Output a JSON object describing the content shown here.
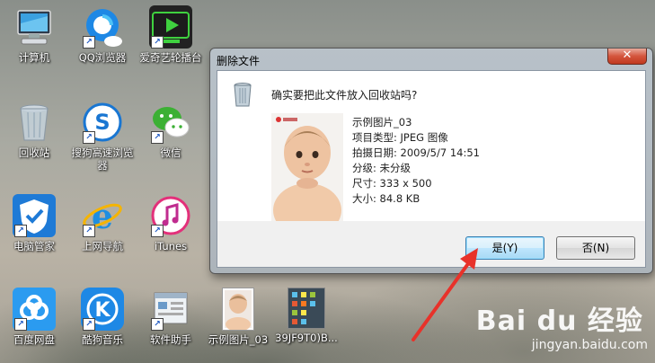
{
  "desktop": {
    "icons": [
      {
        "label": "计算机",
        "icon": "computer-icon"
      },
      {
        "label": "QQ浏览器",
        "icon": "qq-browser-icon"
      },
      {
        "label": "爱奇艺轮播台",
        "icon": "iqiyi-icon"
      },
      {
        "label": "回收站",
        "icon": "recycle-bin-icon"
      },
      {
        "label": "搜狗高速浏览器",
        "icon": "sogou-browser-icon"
      },
      {
        "label": "微信",
        "icon": "wechat-icon"
      },
      {
        "label": "电脑管家",
        "icon": "pc-manager-icon"
      },
      {
        "label": "上网导航",
        "icon": "ie-icon"
      },
      {
        "label": "iTunes",
        "icon": "itunes-icon"
      },
      {
        "label": "百度网盘",
        "icon": "baidu-netdisk-icon"
      },
      {
        "label": "酷狗音乐",
        "icon": "kugou-icon"
      },
      {
        "label": "软件助手",
        "icon": "software-assistant-icon"
      },
      {
        "label": "示例图片_03",
        "icon": "image-file-icon"
      },
      {
        "label": "39JF9T0)B...",
        "icon": "image-file-icon"
      }
    ]
  },
  "dialog": {
    "title": "删除文件",
    "close_label": "✕",
    "question": "确实要把此文件放入回收站吗?",
    "file": {
      "name": "示例图片_03",
      "type": "项目类型: JPEG 图像",
      "date": "拍摄日期: 2009/5/7 14:51",
      "rating": "分级: 未分级",
      "dimensions": "尺寸: 333 x 500",
      "size": "大小: 84.8 KB"
    },
    "yes_label": "是(Y)",
    "no_label": "否(N)"
  },
  "watermark": {
    "logo": "Bai du 经验",
    "url": "jingyan.baidu.com"
  },
  "colors": {
    "arrow": "#e8322a",
    "default_button_border": "#3c7fb1"
  }
}
